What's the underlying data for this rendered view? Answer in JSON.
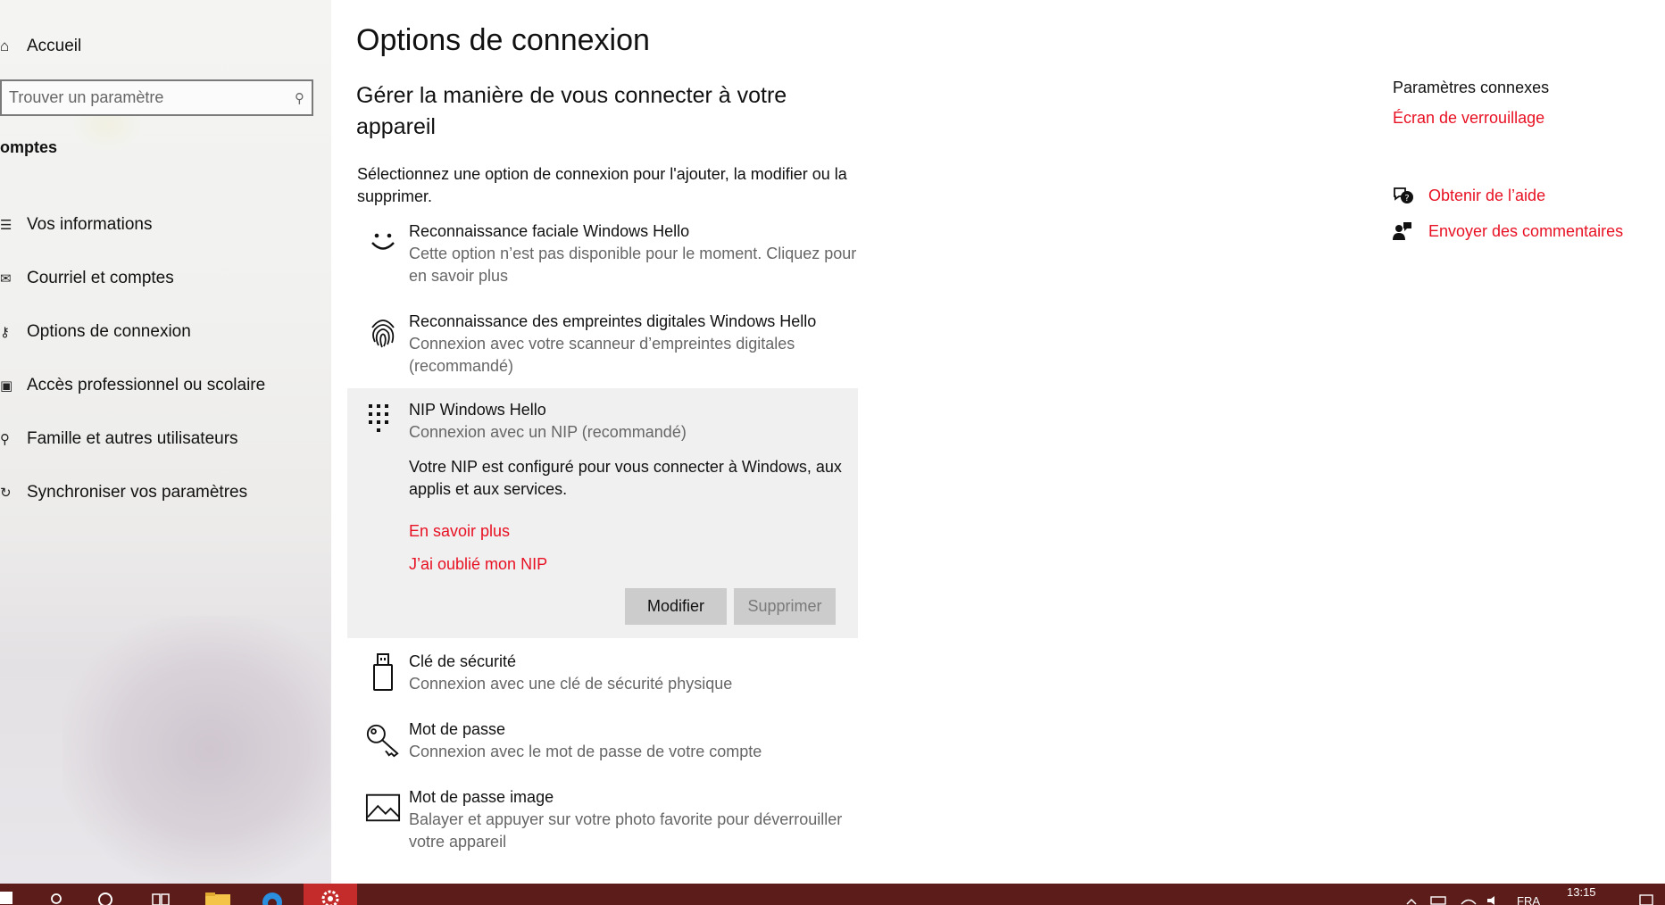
{
  "sidebar": {
    "home_label": "Accueil",
    "search_placeholder": "Trouver un paramètre",
    "section_title": "omptes",
    "items": [
      {
        "label": "Vos informations"
      },
      {
        "label": "Courriel et comptes"
      },
      {
        "label": "Options de connexion"
      },
      {
        "label": "Accès professionnel ou scolaire"
      },
      {
        "label": "Famille et autres utilisateurs"
      },
      {
        "label": "Synchroniser vos paramètres"
      }
    ]
  },
  "main": {
    "title": "Options de connexion",
    "subtitle": "Gérer la manière de vous connecter à votre appareil",
    "intro": "Sélectionnez une option de connexion pour l'ajouter, la modifier ou la supprimer.",
    "options": {
      "face": {
        "title": "Reconnaissance faciale Windows Hello",
        "desc": "Cette option n’est pas disponible pour le moment. Cliquez pour en savoir plus",
        "icon": "face-icon"
      },
      "fingerprint": {
        "title": "Reconnaissance des empreintes digitales Windows Hello",
        "desc": "Connexion avec votre scanneur d’empreintes digitales (recommandé)",
        "icon": "fingerprint-icon"
      },
      "pin": {
        "title": "NIP Windows Hello",
        "desc": "Connexion avec un NIP (recommandé)",
        "icon": "keypad-icon",
        "info": "Votre NIP est configuré pour vous connecter à Windows, aux applis et aux services.",
        "learn_more": "En savoir plus",
        "forgot": "J’ai oublié mon NIP",
        "modify_label": "Modifier",
        "delete_label": "Supprimer"
      },
      "security_key": {
        "title": "Clé de sécurité",
        "desc": "Connexion avec une clé de sécurité physique",
        "icon": "usb-key-icon"
      },
      "password": {
        "title": "Mot de passe",
        "desc": "Connexion avec le mot de passe de votre compte",
        "icon": "key-icon"
      },
      "picture_password": {
        "title": "Mot de passe image",
        "desc": "Balayer et appuyer sur votre photo favorite pour déverrouiller votre appareil",
        "icon": "picture-icon"
      }
    }
  },
  "related": {
    "title": "Paramètres connexes",
    "lock_screen_link": "Écran de verrouillage",
    "help_link": "Obtenir de l’aide",
    "feedback_link": "Envoyer des commentaires"
  },
  "taskbar": {
    "time": "13:15",
    "lang": "FRA"
  },
  "colors": {
    "accent": "#e81123",
    "taskbar": "#5b1c1a",
    "active_app": "#c42b2b",
    "panel_bg": "#f0f0f0"
  }
}
